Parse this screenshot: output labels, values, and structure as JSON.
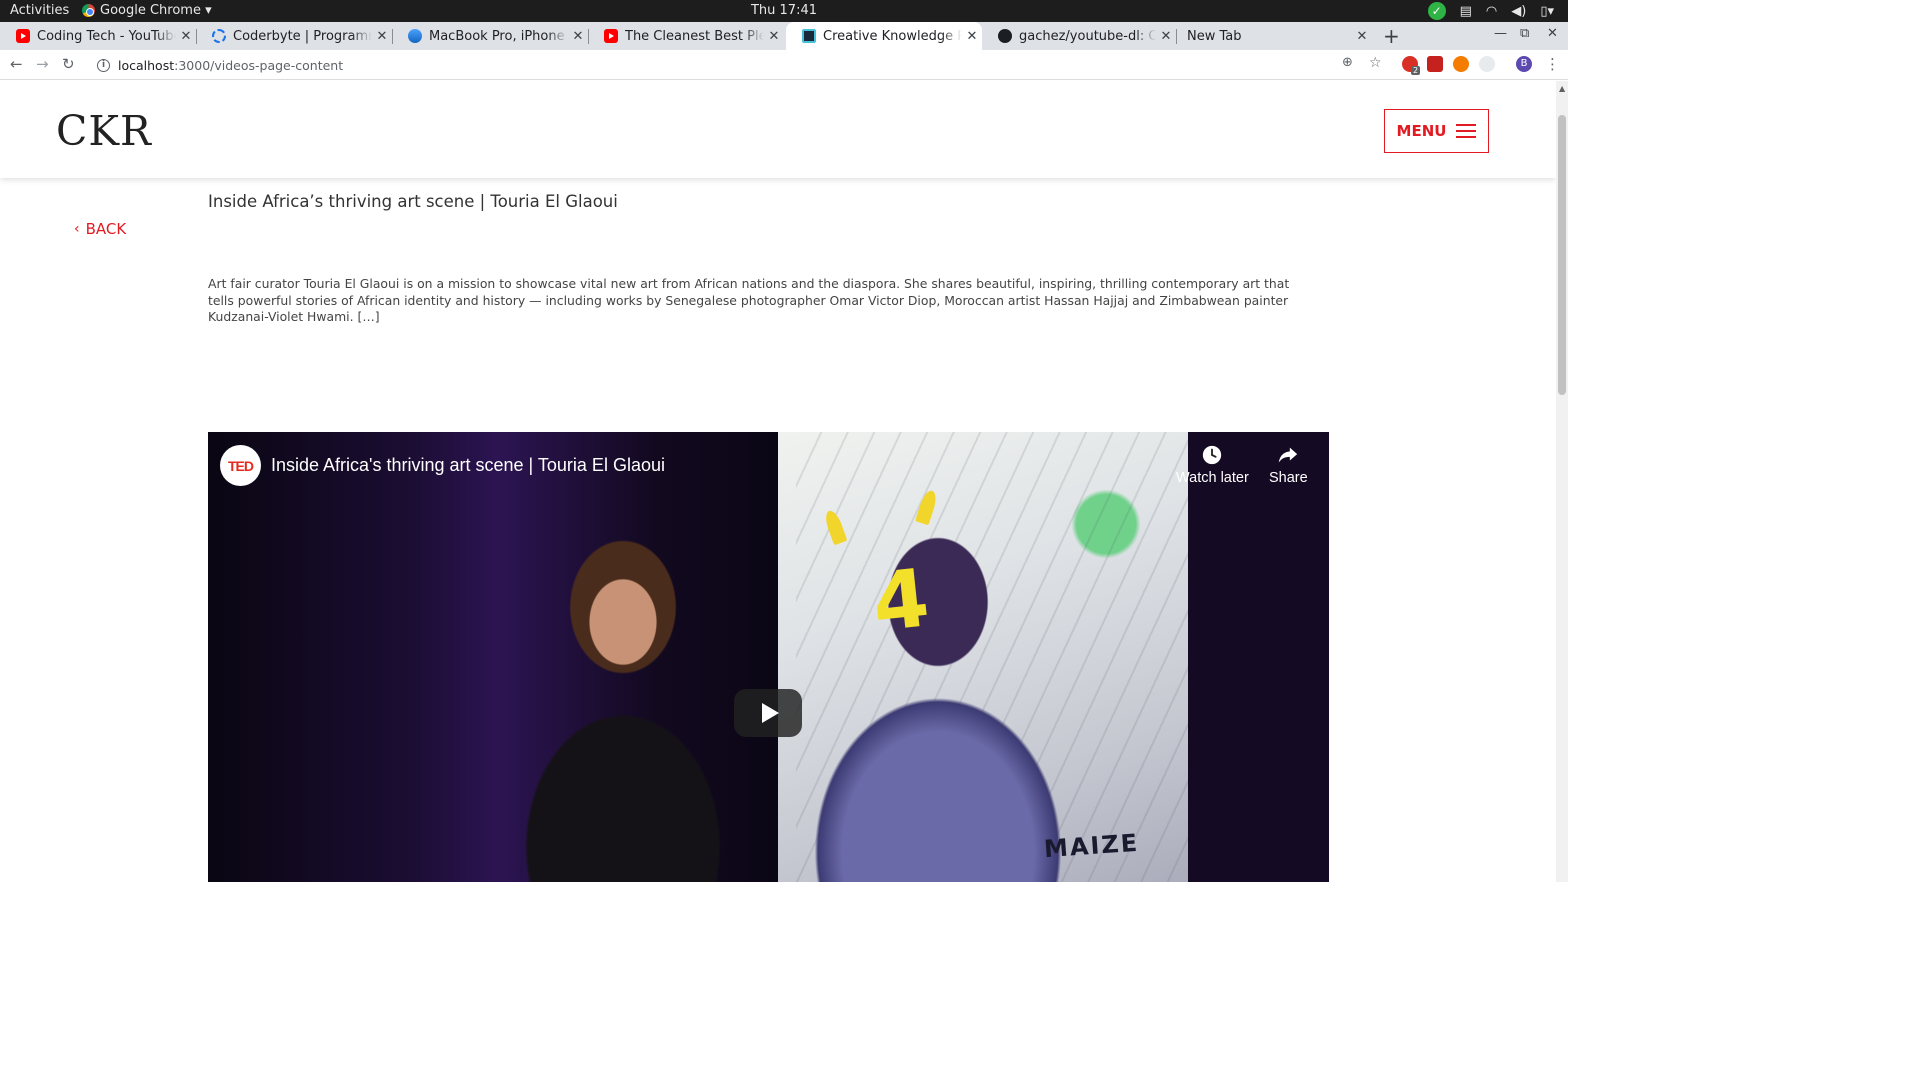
{
  "os": {
    "activities": "Activities",
    "app_name": "Google Chrome ▾",
    "clock": "Thu 17:41"
  },
  "tabs": [
    {
      "label": "Coding Tech - YouTube",
      "icon": "youtube-icon"
    },
    {
      "label": "Coderbyte | Programming",
      "icon": "coderbyte-icon"
    },
    {
      "label": "MacBook Pro, iPhone XS a",
      "icon": "macbook-icon"
    },
    {
      "label": "The Cleanest Best Pleasur",
      "icon": "youtube-icon"
    },
    {
      "label": "Creative Knowledge Reso",
      "icon": "ckr-icon",
      "active": true
    },
    {
      "label": "gachez/youtube-dl: Comm",
      "icon": "github-icon"
    },
    {
      "label": "New Tab",
      "icon": ""
    }
  ],
  "address": {
    "host": "localhost",
    "path": ":3000/videos-page-content"
  },
  "profile_initial": "B",
  "extension_badge": "2",
  "site": {
    "logo": "CKR",
    "menu_label": "MENU",
    "back_label": "BACK",
    "video_title": "Inside Africa’s thriving art scene | Touria El Glaoui",
    "description": "Art fair curator Touria El Glaoui is on a mission to showcase vital new art from African nations and the diaspora. She shares beautiful, inspiring, thrilling contemporary art that tells powerful stories of African identity and history — including works by Senegalese photographer Omar Victor Diop, Moroccan artist Hassan Hajjaj and Zimbabwean painter Kudzanai-Violet Hwami. […]"
  },
  "player": {
    "channel_logo": "TED",
    "title": "Inside Africa's thriving art scene | Touria El Glaoui",
    "watch_later": "Watch later",
    "share": "Share",
    "artwork_number": "4",
    "artwork_text": "MAIZE"
  },
  "colors": {
    "accent": "#e21b23",
    "ted_red": "#e62b1e"
  }
}
